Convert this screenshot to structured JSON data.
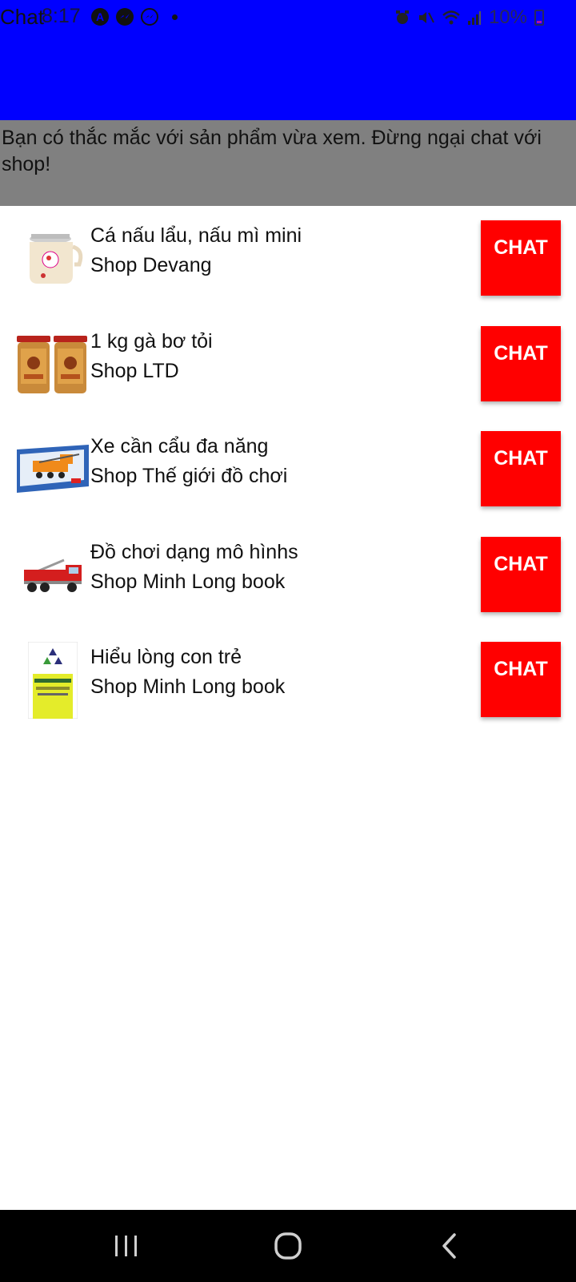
{
  "status_bar": {
    "app_title": "Chat",
    "time": "8:17",
    "battery": "10%",
    "left_icons": [
      "a-circle-icon",
      "messenger-icon",
      "messenger-alt-icon",
      "dot-icon"
    ],
    "right_icons": [
      "alarm-icon",
      "mute-icon",
      "wifi-icon",
      "signal-icon",
      "battery-icon"
    ]
  },
  "notice": {
    "text": "Bạn có thắc mắc với sản phẩm vừa xem. Đừng ngại chat với shop!"
  },
  "products": [
    {
      "name": "Cá nấu lẩu, nấu mì mini",
      "shop": "Shop Devang",
      "button": "CHAT",
      "image": "electric-pot-image"
    },
    {
      "name": "1 kg gà bơ tỏi",
      "shop": "Shop LTD",
      "button": "CHAT",
      "image": "snack-jars-image"
    },
    {
      "name": "Xe cần cẩu đa năng",
      "shop": "Shop Thế giới đồ chơi",
      "button": "CHAT",
      "image": "crane-toy-box-image"
    },
    {
      "name": "Đồ chơi dạng mô hìnhs",
      "shop": "Shop Minh Long book",
      "button": "CHAT",
      "image": "fire-truck-model-image"
    },
    {
      "name": "Hiểu lòng con trẻ",
      "shop": "Shop Minh Long book",
      "button": "CHAT",
      "image": "book-cover-image"
    }
  ],
  "colors": {
    "app_bar": "#0000ff",
    "notice_bg": "#808080",
    "chat_button": "#ff0000",
    "nav_bar": "#000000"
  },
  "nav": {
    "recent_icon": "recent-apps-icon",
    "home_icon": "home-icon",
    "back_icon": "back-icon"
  }
}
